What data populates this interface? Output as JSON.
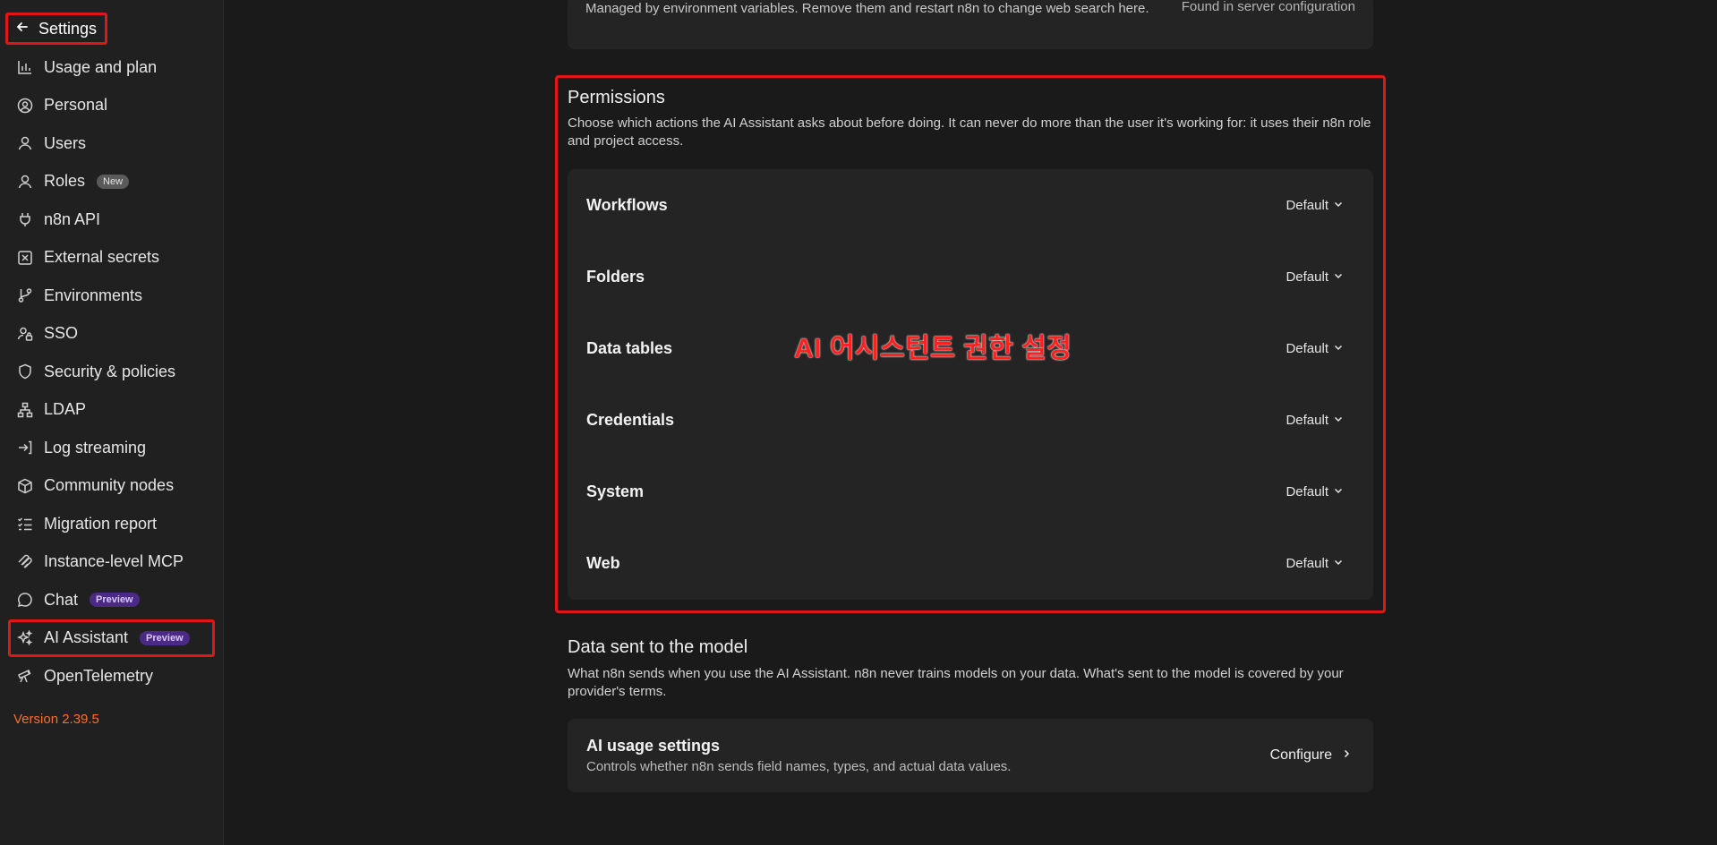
{
  "sidebar": {
    "header": "Settings",
    "items": [
      {
        "label": "Usage and plan",
        "icon": "chart-bars-icon"
      },
      {
        "label": "Personal",
        "icon": "user-circle-icon"
      },
      {
        "label": "Users",
        "icon": "user-icon"
      },
      {
        "label": "Roles",
        "icon": "user-icon",
        "badge": "New"
      },
      {
        "label": "n8n API",
        "icon": "plug-icon"
      },
      {
        "label": "External secrets",
        "icon": "secret-box-icon"
      },
      {
        "label": "Environments",
        "icon": "git-branch-icon"
      },
      {
        "label": "SSO",
        "icon": "user-lock-icon"
      },
      {
        "label": "Security & policies",
        "icon": "shield-icon"
      },
      {
        "label": "LDAP",
        "icon": "network-icon"
      },
      {
        "label": "Log streaming",
        "icon": "log-in-icon"
      },
      {
        "label": "Community nodes",
        "icon": "box-icon"
      },
      {
        "label": "Migration report",
        "icon": "checklist-icon"
      },
      {
        "label": "Instance-level MCP",
        "icon": "mcp-icon"
      },
      {
        "label": "Chat",
        "icon": "chat-bubble-icon",
        "badge": "Preview"
      },
      {
        "label": "AI Assistant",
        "icon": "sparkles-icon",
        "badge": "Preview"
      },
      {
        "label": "OpenTelemetry",
        "icon": "telescope-icon"
      }
    ],
    "version": "Version 2.39.5"
  },
  "top_card": {
    "text": "Managed by environment variables. Remove them and restart n8n to change web search here.",
    "right": "Found in server configuration"
  },
  "permissions": {
    "title": "Permissions",
    "description": "Choose which actions the AI Assistant asks about before doing. It can never do more than the user it's working for: it uses their n8n role and project access.",
    "rows": [
      {
        "label": "Workflows",
        "value": "Default"
      },
      {
        "label": "Folders",
        "value": "Default"
      },
      {
        "label": "Data tables",
        "value": "Default"
      },
      {
        "label": "Credentials",
        "value": "Default"
      },
      {
        "label": "System",
        "value": "Default"
      },
      {
        "label": "Web",
        "value": "Default"
      }
    ],
    "annotation": "AI 어시스턴트 권한 설정"
  },
  "data_sent": {
    "title": "Data sent to the model",
    "description": "What n8n sends when you use the AI Assistant. n8n never trains models on your data. What's sent to the model is covered by your provider's terms.",
    "card_title": "AI usage settings",
    "card_subtitle": "Controls whether n8n sends field names, types, and actual data values.",
    "configure_label": "Configure"
  },
  "colors": {
    "annotation_red": "#e01717",
    "version_orange": "#ff6d2e",
    "preview_badge": "#4b2a86"
  }
}
